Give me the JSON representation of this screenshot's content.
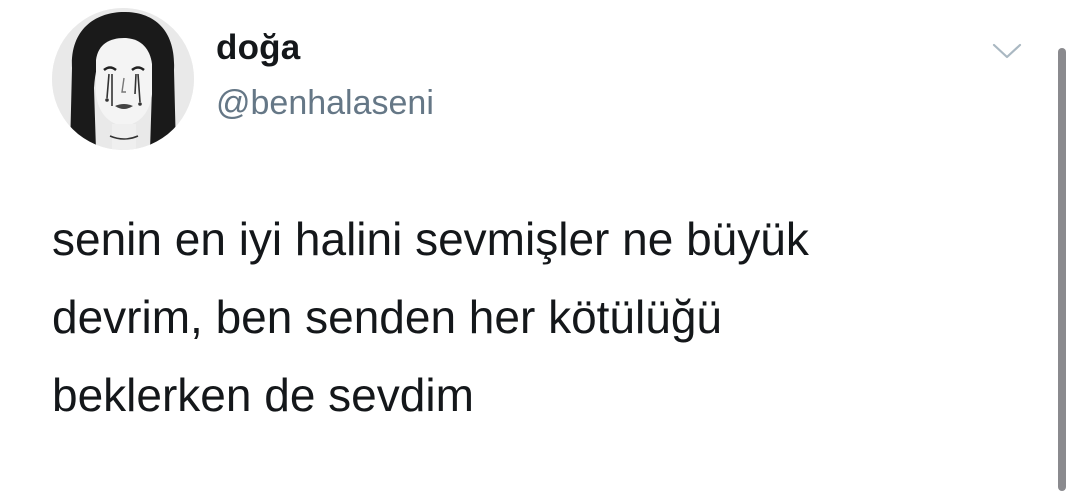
{
  "user": {
    "display_name": "doğa",
    "handle": "@benhalaseni"
  },
  "tweet": {
    "lines": [
      "senin en iyi halini sevmişler ne büyük",
      "devrim, ben senden her kötülüğü",
      "beklerken de sevdim"
    ]
  },
  "icons": {
    "avatar": "profile-picture",
    "menu": "chevron-down-icon"
  },
  "colors": {
    "text": "#14171a",
    "secondary_text": "#657786",
    "caret": "#aab8c2"
  }
}
